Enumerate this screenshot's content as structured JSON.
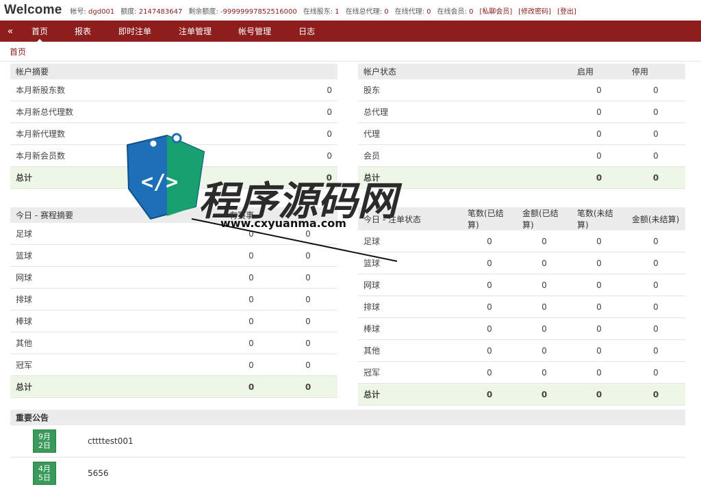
{
  "header": {
    "brand": "Welcome",
    "account_label": "帐号:",
    "account": "dgd001",
    "credit_label": "额度:",
    "credit": "2147483647",
    "remain_label": "剩余额度:",
    "remain": "-99999997852516000",
    "online_holders_label": "在线股东:",
    "online_holders": "1",
    "online_gagents_label": "在线总代理:",
    "online_gagents": "0",
    "online_agents_label": "在线代理:",
    "online_agents": "0",
    "online_members_label": "在线会员:",
    "online_members": "0",
    "link_chat": "[私聊会员]",
    "link_pwd": "[修改密码]",
    "link_logout": "[登出]"
  },
  "nav": {
    "collapse": "«",
    "items": [
      "首页",
      "报表",
      "即时注单",
      "注单管理",
      "帐号管理",
      "日志"
    ]
  },
  "breadcrumb": "首页",
  "account_summary": {
    "title": "帐户摘要",
    "rows": [
      {
        "label": "本月新股东数",
        "value": "0"
      },
      {
        "label": "本月新总代理数",
        "value": "0"
      },
      {
        "label": "本月新代理数",
        "value": "0"
      },
      {
        "label": "本月新会员数",
        "value": "0"
      }
    ],
    "total_label": "总计",
    "total_value": "0"
  },
  "account_status": {
    "title": "帐户状态",
    "col_enabled": "启用",
    "col_disabled": "停用",
    "rows": [
      {
        "label": "股东",
        "enabled": "0",
        "disabled": "0"
      },
      {
        "label": "总代理",
        "enabled": "0",
        "disabled": "0"
      },
      {
        "label": "代理",
        "enabled": "0",
        "disabled": "0"
      },
      {
        "label": "会员",
        "enabled": "0",
        "disabled": "0"
      }
    ],
    "total_label": "总计",
    "total_enabled": "0",
    "total_disabled": "0"
  },
  "today_events": {
    "title": "今日 - 赛程摘要",
    "col_a": "有赛事",
    "rows": [
      {
        "label": "足球",
        "a": "0",
        "b": "0"
      },
      {
        "label": "篮球",
        "a": "0",
        "b": "0"
      },
      {
        "label": "网球",
        "a": "0",
        "b": "0"
      },
      {
        "label": "排球",
        "a": "0",
        "b": "0"
      },
      {
        "label": "棒球",
        "a": "0",
        "b": "0"
      },
      {
        "label": "其他",
        "a": "0",
        "b": "0"
      },
      {
        "label": "冠军",
        "a": "0",
        "b": "0"
      }
    ],
    "total_label": "总计",
    "total_a": "0",
    "total_b": "0"
  },
  "today_bets": {
    "title": "今日 - 注单状态",
    "cols": [
      "笔数(已结算)",
      "金额(已结算)",
      "笔数(未结算)",
      "金额(未结算)"
    ],
    "rows": [
      {
        "label": "足球",
        "v": [
          "0",
          "0",
          "0",
          "0"
        ]
      },
      {
        "label": "篮球",
        "v": [
          "0",
          "0",
          "0",
          "0"
        ]
      },
      {
        "label": "网球",
        "v": [
          "0",
          "0",
          "0",
          "0"
        ]
      },
      {
        "label": "排球",
        "v": [
          "0",
          "0",
          "0",
          "0"
        ]
      },
      {
        "label": "棒球",
        "v": [
          "0",
          "0",
          "0",
          "0"
        ]
      },
      {
        "label": "其他",
        "v": [
          "0",
          "0",
          "0",
          "0"
        ]
      },
      {
        "label": "冠军",
        "v": [
          "0",
          "0",
          "0",
          "0"
        ]
      }
    ],
    "total_label": "总计",
    "total_v": [
      "0",
      "0",
      "0",
      "0"
    ]
  },
  "notices": {
    "title": "重要公告",
    "items": [
      {
        "month": "9月",
        "day": "2日",
        "text": "cttttest001"
      },
      {
        "month": "4月",
        "day": "5日",
        "text": "5656"
      }
    ]
  },
  "watermark": {
    "title": "程序源码网",
    "url": "www.cxyuanma.com"
  },
  "colors": {
    "nav_bg": "#8e1d1d",
    "accent_red": "#8b1a1a",
    "accent_green": "#3aa07a",
    "total_row_bg": "#eef6e7"
  }
}
